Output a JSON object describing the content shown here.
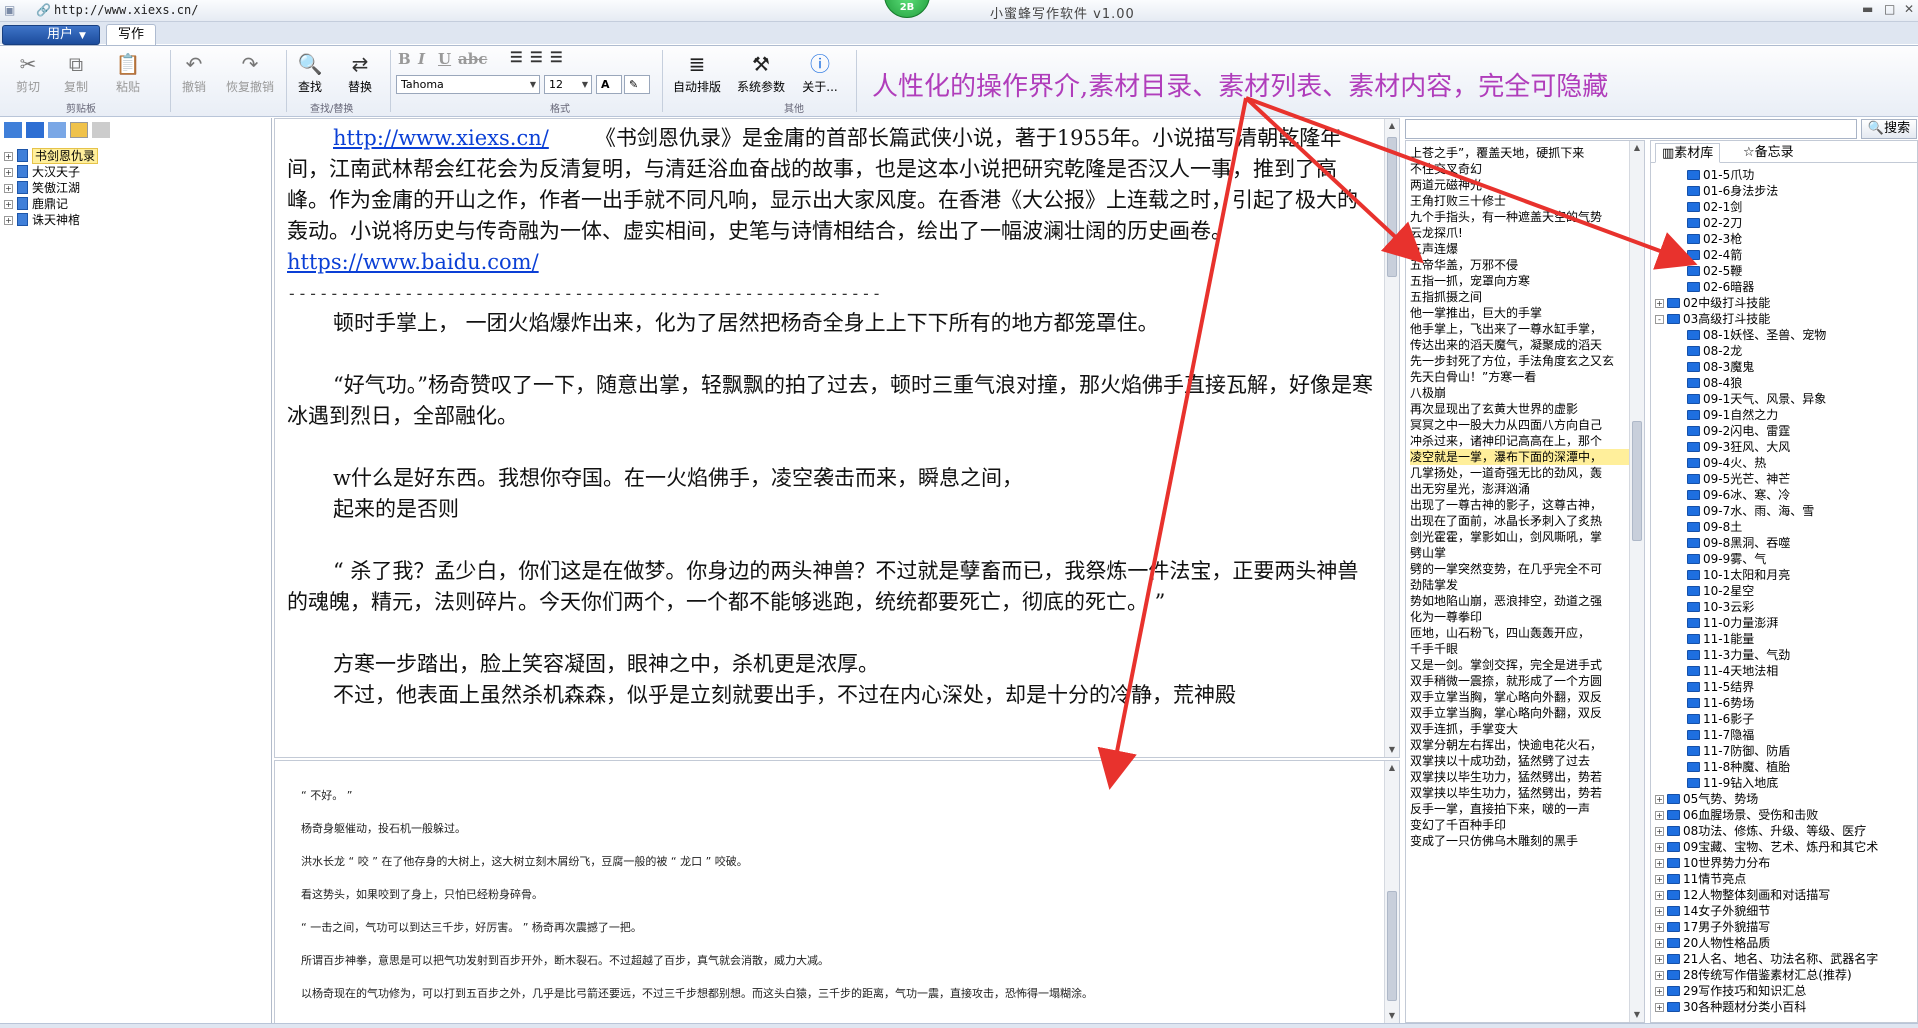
{
  "window": {
    "url": "http://www.xiexs.cn/",
    "title": "小蜜蜂写作软件  v1.00",
    "orb_label": "2B"
  },
  "ribbon": {
    "user_menu": "用户",
    "tab_write": "写作",
    "buttons": {
      "cut": "剪切",
      "copy": "复制",
      "paste": "粘贴",
      "undo": "撤销",
      "redo": "恢复撤销",
      "find": "查找",
      "replace": "替换",
      "auto_layout": "自动排版",
      "settings": "系统参数",
      "about": "关于..."
    },
    "groups": {
      "clipboard": "剪贴板",
      "find_replace": "查找/替换",
      "format": "格式",
      "other": "其他"
    },
    "font_name": "Tahoma",
    "font_size": "12",
    "promo": "人性化的操作界介,素材目录、素材列表、素材内容，完全可隐藏"
  },
  "books": [
    {
      "title": "书剑恩仇录",
      "selected": true
    },
    {
      "title": "大汉天子",
      "selected": false
    },
    {
      "title": "笑傲江湖",
      "selected": false
    },
    {
      "title": "鹿鼎记",
      "selected": false
    },
    {
      "title": "诛天神棺",
      "selected": false
    }
  ],
  "editor": {
    "link1": "http://www.xiexs.cn/",
    "intro": "《书剑恩仇录》是金庸的首部长篇武侠小说，著于1955年。小说描写清朝乾隆年间，江南武林帮会红花会为反清复明，与清廷浴血奋战的故事，也是这本小说把研究乾隆是否汉人一事，推到了高峰。作为金庸的开山之作，作者一出手就不同凡响，显示出大家风度。在香港《大公报》上连载之时，引起了极大的轰动。小说将历史与传奇融为一体、虚实相间，史笔与诗情相结合，绘出了一幅波澜壮阔的历史画卷。",
    "link2": "https://www.baidu.com/",
    "divider": "--------------------------------------------------------",
    "paragraphs": [
      "顿时手掌上，  一团火焰爆炸出来，化为了居然把杨奇全身上上下下所有的地方都笼罩住。",
      "“好气功。”杨奇赞叹了一下，随意出掌，轻飘飘的拍了过去，顿时三重气浪对撞，那火焰佛手直接瓦解，好像是寒冰遇到烈日，全部融化。",
      "w什么是好东西。我想你夺国。在一火焰佛手，凌空袭击而来，瞬息之间，",
      "起来的是否则",
      "“  杀了我？孟少白，你们这是在做梦。你身边的两头神兽？不过就是孽畜而已，我祭炼一件法宝，正要两头神兽的魂魄，精元，法则碎片。今天你们两个，一个都不能够逃跑，统统都要死亡，彻底的死亡。  ”",
      "方寒一步踏出，脸上笑容凝固，眼神之中，杀机更是浓厚。",
      "不过，他表面上虽然杀机森森，似乎是立刻就要出手，不过在内心深处，却是十分的冷静，荒神殿"
    ]
  },
  "preview": [
    "“ 不好。 ”",
    "杨奇身躯催动，投石机一般躲过。",
    "洪水长龙 “ 咬 ” 在了他存身的大树上，这大树立刻木屑纷飞，豆腐一般的被 “ 龙口 ” 咬破。",
    "看这势头，如果咬到了身上，只怕已经粉身碎骨。",
    "“ 一击之间，气功可以到达三千步，好厉害。 ” 杨奇再次震撼了一把。",
    "所谓百步神拳，意思是可以把气功发射到百步开外，断木裂石。不过超越了百步，真气就会消散，威力大减。",
    "以杨奇现在的气功修为，可以打到五百步之外，几乎是比弓箭还要远，不过三千步想都别想。而这头白猿，三千步的距离，气功一震，直接攻击，恐怖得一塌糊涂。"
  ],
  "search": {
    "button": "搜索"
  },
  "material_list": [
    "上苍之手”，覆盖天地，硬抓下来",
    "不住交叉奇幻",
    "两道元磁神光",
    "王角打败三十修士",
    "九个手指头，有一种遮盖天空的气势",
    "云龙探爪!",
    "五声连爆",
    "五帝华盖，万邪不侵",
    "五指一抓，宠罩向方寒",
    "五指抓摄之间",
    "他一掌推出，巨大的手掌",
    "他手掌上，飞出来了一尊水缸手掌，",
    "传达出来的滔天魔气，凝聚成的滔天",
    "先一步封死了方位，手法角度玄之又玄",
    "先天白骨山！”方寒一看",
    "八极崩",
    "再次显现出了玄黄大世界的虚影",
    "冥冥之中一股大力从四面八方向自己",
    "冲杀过来，诸神印记高高在上，那个",
    "凌空就是一掌，瀑布下面的深潭中，",
    "几掌扬处，一道奇强无比的劲风，轰",
    "出无穷星光，澎湃汹涌",
    "出现了一尊古神的影子，这尊古神，",
    "出现在了面前，冰晶长矛刺入了炙热",
    "剑光霍霍，掌影如山，剑风嘶吼，掌",
    "劈山掌",
    "劈的一掌突然变势，在几乎完全不可",
    "劲陆掌发",
    "势如地陷山崩，恶浪排空，劲道之强",
    "化为一尊拳印",
    "匝地，山石粉飞，四山轰轰开应，",
    "千手千眼",
    "又是一剑。掌剑交挥，完全是进手式",
    "双手稍微一震捺，就形成了一个方圆",
    "双手立掌当胸，掌心略向外翻，双反",
    "双手立掌当胸，掌心略向外翻，双反",
    "双手连抓，手掌变大",
    "双掌分朝左右挥出，快逾电花火石，",
    "双掌挟以十成功劲，猛然劈了过去",
    "双掌挟以毕生功力，猛然劈出，势若",
    "双掌挟以毕生功力，猛然劈出，势若",
    "反手一掌，直接拍下来，啵的一声",
    "变幻了千百种手印",
    "变成了一只仿佛乌木雕刻的黑手"
  ],
  "material_highlight_index": 19,
  "library": {
    "tab_library": "素材库",
    "tab_memo": "备忘录",
    "nodes": [
      {
        "label": "01-5爪功",
        "level": 1
      },
      {
        "label": "01-6身法步法",
        "level": 1
      },
      {
        "label": "02-1剑",
        "level": 1
      },
      {
        "label": "02-2刀",
        "level": 1
      },
      {
        "label": "02-3枪",
        "level": 1
      },
      {
        "label": "02-4箭",
        "level": 1
      },
      {
        "label": "02-5鞭",
        "level": 1
      },
      {
        "label": "02-6暗器",
        "level": 1
      },
      {
        "label": "02中级打斗技能",
        "level": 0,
        "toggle": "+"
      },
      {
        "label": "03高级打斗技能",
        "level": 0,
        "toggle": "-"
      },
      {
        "label": "08-1妖怪、圣兽、宠物",
        "level": 1
      },
      {
        "label": "08-2龙",
        "level": 1
      },
      {
        "label": "08-3魔鬼",
        "level": 1
      },
      {
        "label": "08-4狼",
        "level": 1
      },
      {
        "label": "09-1天气、风景、异象",
        "level": 1
      },
      {
        "label": "09-1自然之力",
        "level": 1
      },
      {
        "label": "09-2闪电、雷霆",
        "level": 1
      },
      {
        "label": "09-3狂风、大风",
        "level": 1
      },
      {
        "label": "09-4火、热",
        "level": 1
      },
      {
        "label": "09-5光芒、神芒",
        "level": 1
      },
      {
        "label": "09-6冰、寒、冷",
        "level": 1
      },
      {
        "label": "09-7水、雨、海、雪",
        "level": 1
      },
      {
        "label": "09-8土",
        "level": 1
      },
      {
        "label": "09-8黑洞、吞噬",
        "level": 1
      },
      {
        "label": "09-9雾、气",
        "level": 1
      },
      {
        "label": "10-1太阳和月亮",
        "level": 1
      },
      {
        "label": "10-2星空",
        "level": 1
      },
      {
        "label": "10-3云彩",
        "level": 1
      },
      {
        "label": "11-0力量澎湃",
        "level": 1
      },
      {
        "label": "11-1能量",
        "level": 1
      },
      {
        "label": "11-3力量、气劲",
        "level": 1
      },
      {
        "label": "11-4天地法相",
        "level": 1
      },
      {
        "label": "11-5结界",
        "level": 1
      },
      {
        "label": "11-6势场",
        "level": 1
      },
      {
        "label": "11-6影子",
        "level": 1
      },
      {
        "label": "11-7隐福",
        "level": 1
      },
      {
        "label": "11-7防御、防盾",
        "level": 1
      },
      {
        "label": "11-8种魔、植胎",
        "level": 1
      },
      {
        "label": "11-9钻入地底",
        "level": 1
      },
      {
        "label": "05气势、势场",
        "level": 0,
        "toggle": "+"
      },
      {
        "label": "06血腥场景、受伤和击败",
        "level": 0,
        "toggle": "+"
      },
      {
        "label": "08功法、修炼、升级、等级、医疗",
        "level": 0,
        "toggle": "+"
      },
      {
        "label": "09宝藏、宝物、艺术、炼丹和其它术",
        "level": 0,
        "toggle": "+"
      },
      {
        "label": "10世界势力分布",
        "level": 0,
        "toggle": "+"
      },
      {
        "label": "11情节亮点",
        "level": 0,
        "toggle": "+"
      },
      {
        "label": "12人物整体刻画和对话描写",
        "level": 0,
        "toggle": "+"
      },
      {
        "label": "14女子外貌细节",
        "level": 0,
        "toggle": "+"
      },
      {
        "label": "17男子外貌描写",
        "level": 0,
        "toggle": "+"
      },
      {
        "label": "20人物性格品质",
        "level": 0,
        "toggle": "+"
      },
      {
        "label": "21人名、地名、功法名称、武器名字",
        "level": 0,
        "toggle": "+"
      },
      {
        "label": "28传统写作借鉴素材汇总(推荐)",
        "level": 0,
        "toggle": "+"
      },
      {
        "label": "29写作技巧和知识汇总",
        "level": 0,
        "toggle": "+"
      },
      {
        "label": "30各种题材分类小百科",
        "level": 0,
        "toggle": "+"
      }
    ]
  },
  "colors": {
    "promo": "#b03dbb",
    "arrow": "#e8322d",
    "link": "#0a3fd6",
    "highlight": "#ffef9b"
  }
}
